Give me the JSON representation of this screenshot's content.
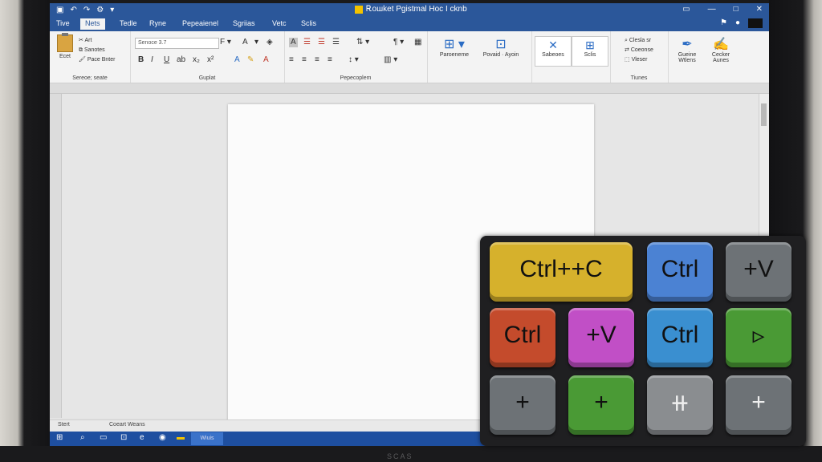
{
  "window": {
    "title": "Ꭱoшket Pgistmal Hoc I cknb",
    "qat_icons": [
      "save-icon",
      "undo-icon",
      "redo-icon",
      "settings-icon"
    ],
    "controls": [
      "▭",
      "□",
      "✕"
    ]
  },
  "tabs": [
    "Tive",
    "Nets",
    "Tedle",
    "Ryne",
    "Pepeaienel",
    "Sgriias",
    "Vetc",
    "Sclis"
  ],
  "active_tab": "Nets",
  "ribbon": {
    "clipboard": {
      "paste": "Ecet",
      "items": [
        "Art",
        "Sanotes",
        "Pace Bnter"
      ],
      "label": "Sereoe; seate"
    },
    "font": {
      "name": "Senoce 3.7",
      "label": "Guplat"
    },
    "paragraph": {
      "label": "Pepecoplem"
    },
    "styles": {
      "items": [
        "Paroeneme",
        "Povaid · Ayoin"
      ],
      "label": ""
    },
    "styles_boxes": [
      "Sabeoes",
      "Sclis"
    ],
    "editing": {
      "items": [
        "Clesla sr",
        "Coeonse",
        "Vleser"
      ],
      "label": "Tiunes"
    },
    "right_buttons": [
      "Gueine Wtlens",
      "Cecker Aunes"
    ]
  },
  "status": {
    "left": "Stert",
    "center": "Coeart Weans"
  },
  "taskbar": {
    "active_label": "Wiuis"
  },
  "keypad": {
    "keys": [
      {
        "label": "Ctrl++C",
        "color": "#d6b12c"
      },
      {
        "label": "Ctrl",
        "color": "#4b82d3"
      },
      {
        "label": "+V",
        "color": "#6d7276"
      },
      {
        "label": "Ctrl",
        "color": "#c44b2c"
      },
      {
        "label": "+V",
        "color": "#c14fc6"
      },
      {
        "label": "Ctrl",
        "color": "#3a8fd0"
      },
      {
        "label": "▹",
        "color": "#4a9a35"
      },
      {
        "label": "+",
        "color": "#6d7276"
      },
      {
        "label": "+",
        "color": "#4a9a35"
      },
      {
        "label": "⧺",
        "color": "#8a8d90"
      },
      {
        "label": "+",
        "color": "#6d7276"
      }
    ]
  },
  "monitor_brand": "SCAS"
}
